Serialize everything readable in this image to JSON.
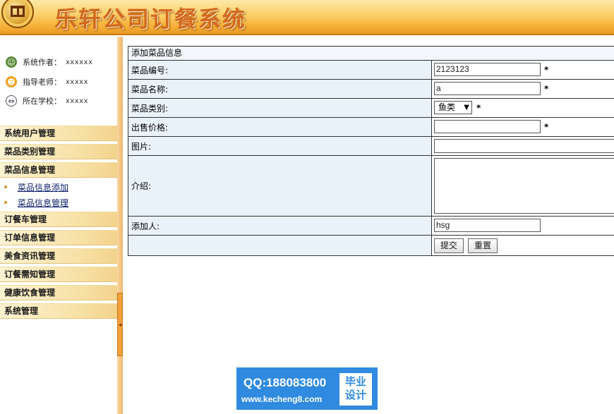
{
  "header": {
    "title": "乐轩公司订餐系统"
  },
  "sidebar": {
    "info": [
      {
        "label": "系统作者：",
        "value": "xxxxxx",
        "icon": "user-group-icon"
      },
      {
        "label": "指导老师：",
        "value": "xxxxx",
        "icon": "teacher-icon"
      },
      {
        "label": "所在学校：",
        "value": "xxxxx",
        "icon": "school-icon"
      }
    ],
    "menu": [
      {
        "label": "系统用户管理"
      },
      {
        "label": "菜品类别管理"
      },
      {
        "label": "菜品信息管理",
        "children": [
          {
            "label": "菜品信息添加"
          },
          {
            "label": "菜品信息管理"
          }
        ]
      },
      {
        "label": "订餐车管理"
      },
      {
        "label": "订单信息管理"
      },
      {
        "label": "美食资讯管理"
      },
      {
        "label": "订餐需知管理"
      },
      {
        "label": "健康饮食管理"
      },
      {
        "label": "系统管理"
      }
    ]
  },
  "form": {
    "caption": "添加菜品信息",
    "fields": {
      "dish_no": {
        "label": "菜品编号:",
        "value": "2123123",
        "required": "*"
      },
      "dish_name": {
        "label": "菜品名称:",
        "value": "a",
        "required": "*"
      },
      "category": {
        "label": "菜品类别:",
        "value": "鱼类",
        "arrow": "▼",
        "required": "*"
      },
      "price": {
        "label": "出售价格:",
        "value": "",
        "required": "*"
      },
      "image": {
        "label": "图片:"
      },
      "intro": {
        "label": "介绍:"
      },
      "added_by": {
        "label": "添加人:",
        "value": "hsg"
      }
    },
    "buttons": {
      "submit": "提交",
      "reset": "重置"
    }
  },
  "watermark": {
    "qq": "QQ:188083800",
    "url": "www.kecheng8.com",
    "badge_line1": "毕业",
    "badge_line2": "设计"
  }
}
